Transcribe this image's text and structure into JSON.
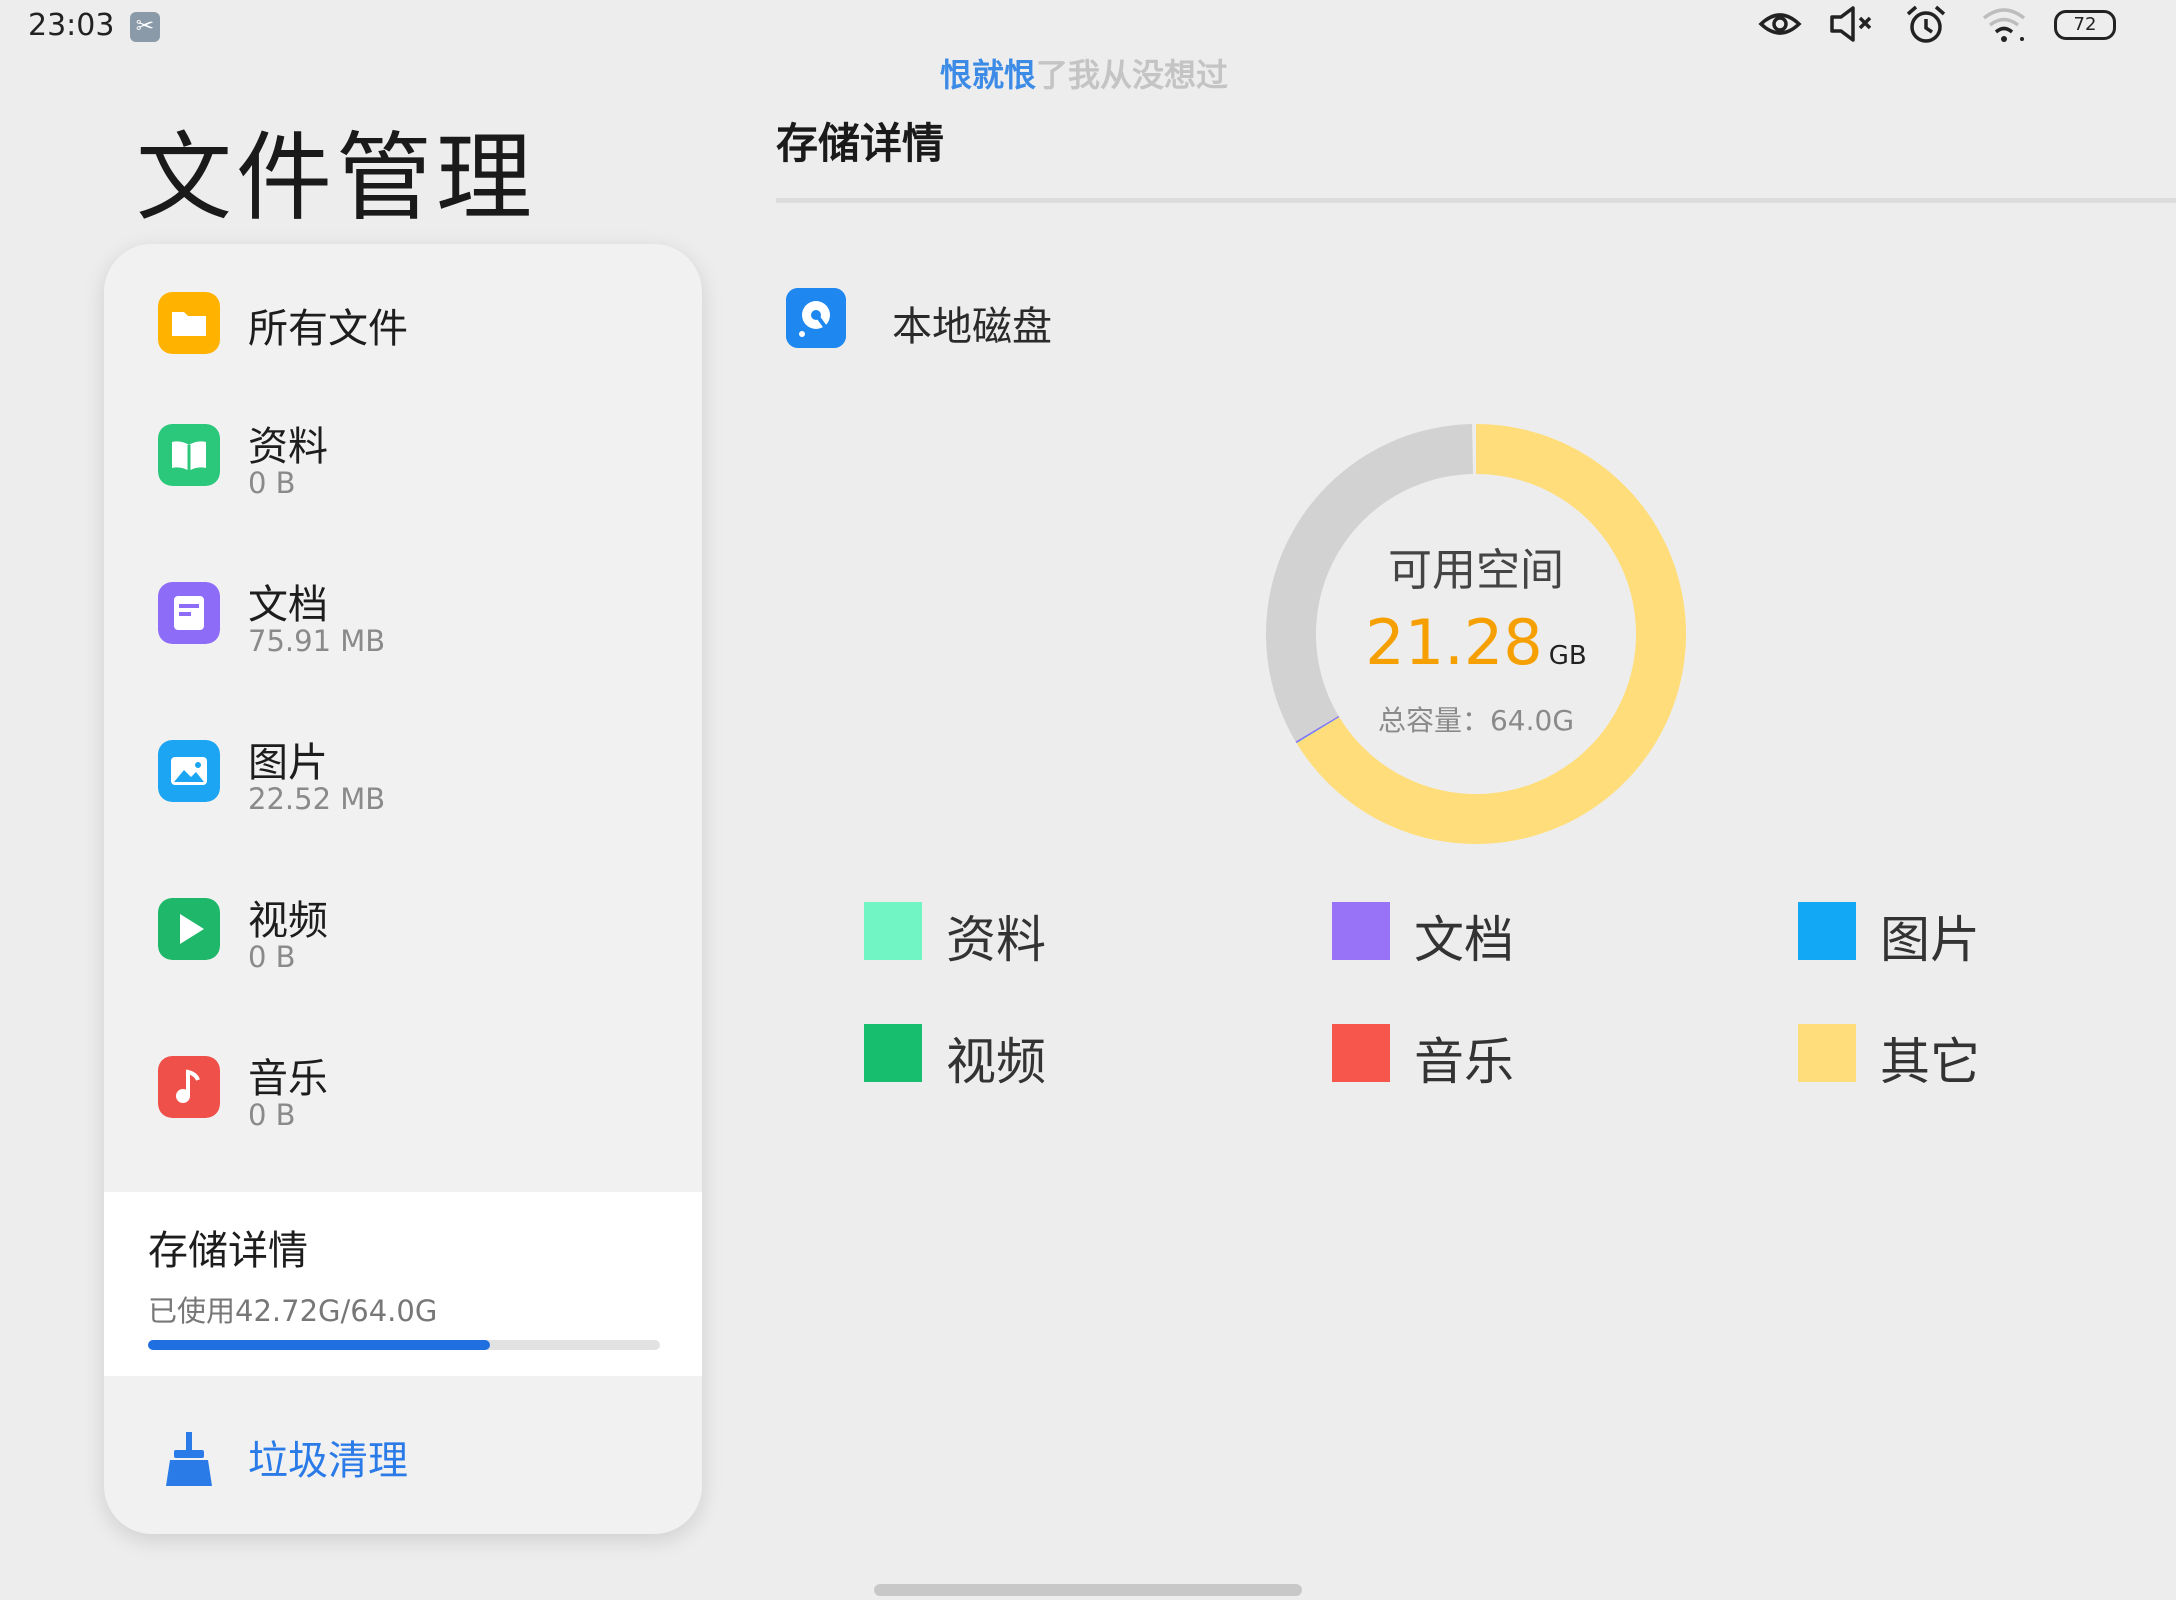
{
  "status_bar": {
    "time": "23:03",
    "battery": "72",
    "icons": [
      "scissors-icon",
      "eye-icon",
      "mute-icon",
      "alarm-icon",
      "wifi-icon",
      "battery-icon"
    ]
  },
  "lyric": {
    "highlighted": "恨就恨",
    "rest": "了我从没想过"
  },
  "app_title": "文件管理",
  "page_heading": "存储详情",
  "sidebar": {
    "categories": [
      {
        "name": "所有文件",
        "size": "",
        "color": "#FFB300",
        "icon": "folder-icon"
      },
      {
        "name": "资料",
        "size": "0 B",
        "color": "#2BC87C",
        "icon": "book-icon"
      },
      {
        "name": "文档",
        "size": "75.91 MB",
        "color": "#8D6CF7",
        "icon": "document-icon"
      },
      {
        "name": "图片",
        "size": "22.52 MB",
        "color": "#1BA5F2",
        "icon": "image-icon"
      },
      {
        "name": "视频",
        "size": "0 B",
        "color": "#1FB86A",
        "icon": "play-icon"
      },
      {
        "name": "音乐",
        "size": "0 B",
        "color": "#F0504A",
        "icon": "music-icon"
      }
    ],
    "storage": {
      "title": "存储详情",
      "used_text": "已使用42.72G/64.0G",
      "used_fraction": 0.6675
    },
    "cleanup": {
      "label": "垃圾清理",
      "icon": "broom-icon"
    }
  },
  "disk": {
    "label": "本地磁盘",
    "icon": "disk-icon"
  },
  "usage": {
    "free_label": "可用空间",
    "free_value": "21.28",
    "free_unit": "GB",
    "total_label": "总容量：64.0G",
    "segments": [
      {
        "name": "其它",
        "fraction": 0.663,
        "color": "#FFDD7A"
      },
      {
        "name": "图片",
        "fraction": 0.0004,
        "color": "#1BA5F2"
      },
      {
        "name": "文档",
        "fraction": 0.0011,
        "color": "#8D6CF7"
      },
      {
        "name": "可用空间",
        "fraction": 0.3325,
        "color": "#D2D2D2"
      }
    ]
  },
  "legend": [
    {
      "label": "资料",
      "color": "#72F5C4"
    },
    {
      "label": "文档",
      "color": "#9873F8"
    },
    {
      "label": "图片",
      "color": "#12A8F5"
    },
    {
      "label": "视频",
      "color": "#17BE6E"
    },
    {
      "label": "音乐",
      "color": "#F7564D"
    },
    {
      "label": "其它",
      "color": "#FFDD7A"
    }
  ]
}
